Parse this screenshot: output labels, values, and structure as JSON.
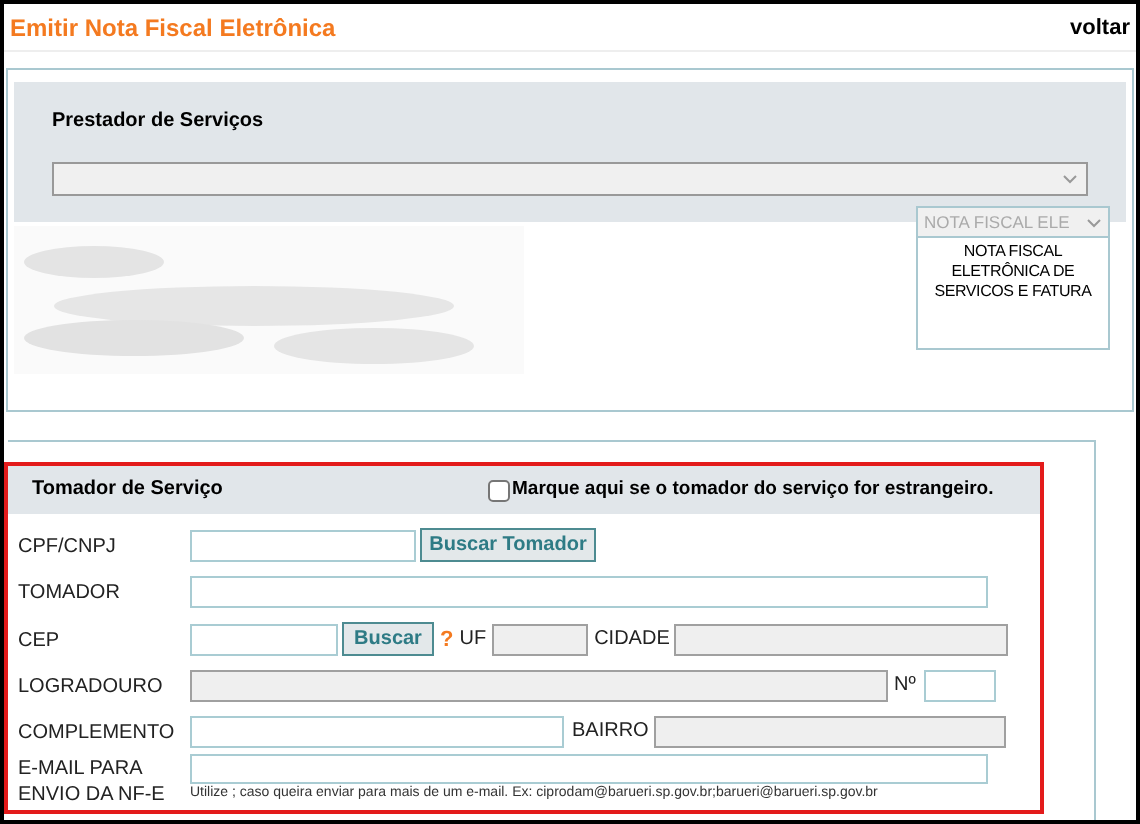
{
  "title": "Emitir Nota Fiscal Eletrônica",
  "back_link": "voltar",
  "provider": {
    "heading": "Prestador de Serviços"
  },
  "invoice_type": {
    "value": "NOTA FISCAL ELE",
    "list_item": "NOTA FISCAL ELETRÔNICA DE SERVICOS E FATURA"
  },
  "taker": {
    "heading": "Tomador de Serviço",
    "foreign_checkbox": {
      "label": "Marque aqui se o tomador do serviço for estrangeiro.",
      "checked": false
    },
    "cpf": {
      "label": "CPF/CNPJ",
      "disabled": false,
      "button": "Buscar Tomador"
    },
    "tomador": {
      "label": "TOMADOR",
      "disabled": false
    },
    "cep": {
      "label": "CEP",
      "disabled": false,
      "button": "Buscar",
      "help": "?"
    },
    "uf": {
      "label": "UF",
      "disabled": true
    },
    "cidade": {
      "label": "CIDADE",
      "disabled": true
    },
    "logradouro": {
      "label": "LOGRADOURO",
      "disabled": true
    },
    "numero": {
      "label": "Nº",
      "disabled": false
    },
    "complemento": {
      "label": "COMPLEMENTO",
      "disabled": false
    },
    "bairro": {
      "label": "BAIRRO",
      "disabled": true
    },
    "email": {
      "label": "E-MAIL PARA ENVIO DA NF-E",
      "disabled": false,
      "hint": "Utilize ; caso queira enviar para mais de um e-mail. Ex: ciprodam@barueri.sp.gov.br;barueri@barueri.sp.gov.br"
    }
  }
}
